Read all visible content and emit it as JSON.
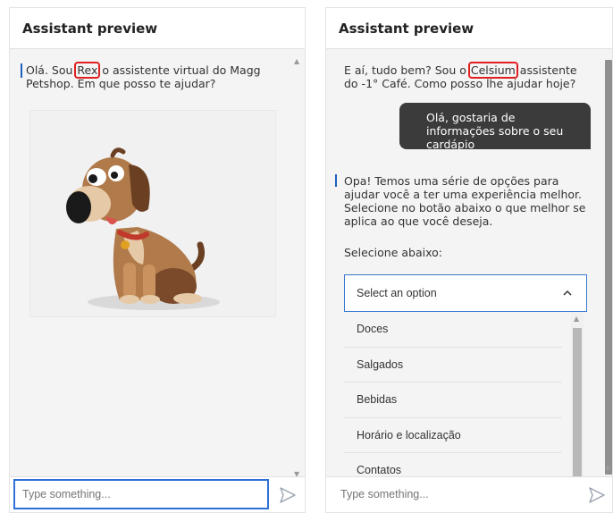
{
  "left_panel": {
    "header": "Assistant preview",
    "message_before": "Olá. Sou ",
    "highlight": "Rex",
    "message_after": " o assistente virtual do Magg Petshop. Em que posso te ajudar?",
    "input_placeholder": "Type something..."
  },
  "right_panel": {
    "header": "Assistant preview",
    "greeting_before": "E aí, tudo bem? Sou o ",
    "highlight": "Celsium",
    "greeting_after": " assistente do -1° Café. Como posso lhe ajudar hoje?",
    "user_message": "Olá, gostaria de informações sobre o seu cardápio",
    "bot_reply": "Opa! Temos uma série de opções para ajudar você a ter uma experiência melhor. Selecione no botão abaixo o que melhor se aplica ao que você deseja.",
    "select_prompt": "Selecione abaixo:",
    "select_placeholder": "Select an option",
    "options": [
      "Doces",
      "Salgados",
      "Bebidas",
      "Horário e localização",
      "Contatos"
    ],
    "input_placeholder": "Type something..."
  },
  "colors": {
    "accent_blue": "#2f6fd6",
    "highlight_red": "#e02020",
    "user_bubble": "#3b3b3b"
  }
}
